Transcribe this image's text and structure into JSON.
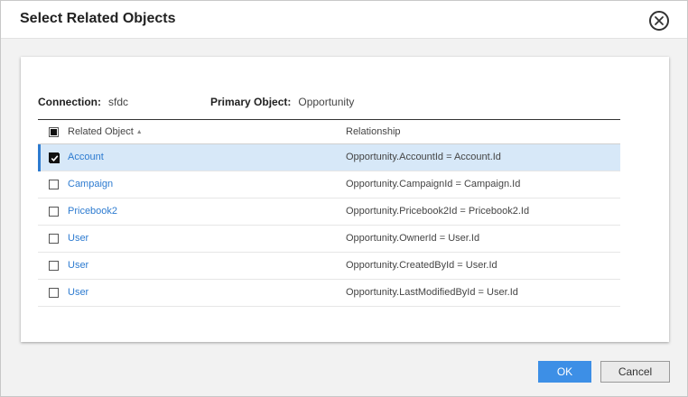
{
  "dialog": {
    "title": "Select Related Objects",
    "ok_label": "OK",
    "cancel_label": "Cancel"
  },
  "meta": {
    "connection_label": "Connection:",
    "connection_value": "sfdc",
    "primary_label": "Primary Object:",
    "primary_value": "Opportunity"
  },
  "table": {
    "columns": [
      "Related Object",
      "Relationship"
    ],
    "header_checkbox_state": "partial",
    "rows": [
      {
        "object": "Account",
        "relationship": "Opportunity.AccountId = Account.Id",
        "checked": true
      },
      {
        "object": "Campaign",
        "relationship": "Opportunity.CampaignId = Campaign.Id",
        "checked": false
      },
      {
        "object": "Pricebook2",
        "relationship": "Opportunity.Pricebook2Id = Pricebook2.Id",
        "checked": false
      },
      {
        "object": "User",
        "relationship": "Opportunity.OwnerId = User.Id",
        "checked": false
      },
      {
        "object": "User",
        "relationship": "Opportunity.CreatedById = User.Id",
        "checked": false
      },
      {
        "object": "User",
        "relationship": "Opportunity.LastModifiedById = User.Id",
        "checked": false
      }
    ]
  },
  "colors": {
    "accent": "#2d7bd0",
    "ok_button": "#3d8fe6",
    "selected_row": "#d7e8f8"
  },
  "icons": {
    "close": "close-circle-icon",
    "sort": "sort-ascending-icon"
  }
}
